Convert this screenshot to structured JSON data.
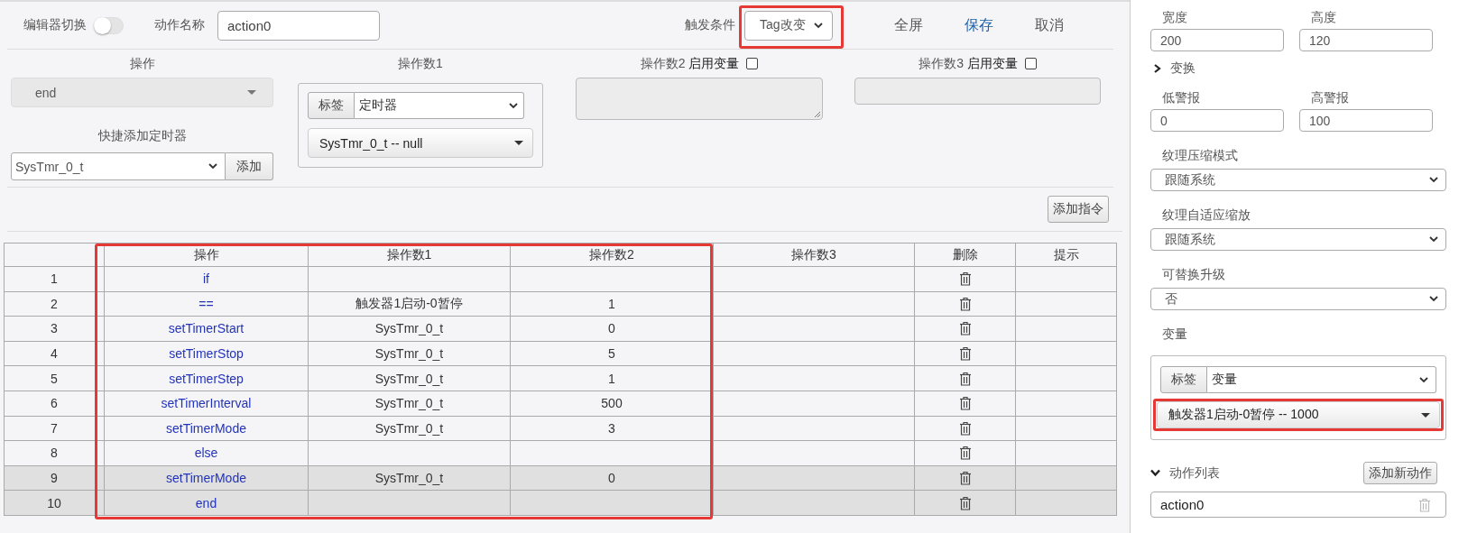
{
  "toolbar": {
    "editor_switch": {
      "label": "编辑器切换",
      "on": false
    },
    "action_name": {
      "label": "动作名称",
      "value": "action0"
    },
    "trigger": {
      "label": "触发条件",
      "value": "Tag改变",
      "marked": true
    },
    "buttons": [
      {
        "label": "全屏",
        "kind": "plain"
      },
      {
        "label": "保存",
        "kind": "primary"
      },
      {
        "label": "取消",
        "kind": "plain"
      }
    ]
  },
  "operation": {
    "label": "操作",
    "value": "end",
    "disabled": true
  },
  "quick_timer": {
    "label": "快捷添加定时器",
    "value": "SysTmr_0_t",
    "button": "添加"
  },
  "operands": [
    {
      "label": "操作数1",
      "kind": "tag",
      "tag_button": "标签",
      "category": "定时器",
      "value": "SysTmr_0_t -- null"
    },
    {
      "label": "操作数2",
      "kind": "textarea",
      "variable_label": "启用变量",
      "checked": false
    },
    {
      "label": "操作数3",
      "kind": "input",
      "variable_label": "启用变量",
      "checked": false
    }
  ],
  "add_instruction": "添加指令",
  "table": {
    "columns": [
      {
        "label": "操作",
        "marked": true
      },
      {
        "label": "操作数1",
        "marked": true
      },
      {
        "label": "操作数2",
        "marked": true
      },
      {
        "label": "操作数3",
        "marked": false
      },
      {
        "label": "删除",
        "marked": false
      },
      {
        "label": "提示",
        "marked": false
      }
    ],
    "rows": [
      {
        "number": "1",
        "operation": "if",
        "highlighted": false
      },
      {
        "number": "2",
        "operation": "==",
        "operand1": "触发器1启动-0暂停",
        "operand2": "1",
        "highlighted": false
      },
      {
        "number": "3",
        "operation": "setTimerStart",
        "operand1": "SysTmr_0_t",
        "operand2": "0",
        "highlighted": false
      },
      {
        "number": "4",
        "operation": "setTimerStop",
        "operand1": "SysTmr_0_t",
        "operand2": "5",
        "highlighted": false
      },
      {
        "number": "5",
        "operation": "setTimerStep",
        "operand1": "SysTmr_0_t",
        "operand2": "1",
        "highlighted": false
      },
      {
        "number": "6",
        "operation": "setTimerInterval",
        "operand1": "SysTmr_0_t",
        "operand2": "500",
        "highlighted": false
      },
      {
        "number": "7",
        "operation": "setTimerMode",
        "operand1": "SysTmr_0_t",
        "operand2": "3",
        "highlighted": false
      },
      {
        "number": "8",
        "operation": "else",
        "highlighted": false
      },
      {
        "number": "9",
        "operation": "setTimerMode",
        "operand1": "SysTmr_0_t",
        "operand2": "0",
        "highlighted": true
      },
      {
        "number": "10",
        "operation": "end",
        "highlighted": true
      }
    ]
  },
  "properties": {
    "size": [
      {
        "label": "宽度",
        "value": "200"
      },
      {
        "label": "高度",
        "value": "120"
      }
    ],
    "transform": {
      "label": "变换",
      "expanded": false
    },
    "alarms": [
      {
        "label": "低警报",
        "value": "0"
      },
      {
        "label": "高警报",
        "value": "100"
      }
    ],
    "selects": [
      {
        "label": "纹理压缩模式",
        "value": "跟随系统"
      },
      {
        "label": "纹理自适应缩放",
        "value": "跟随系统"
      },
      {
        "label": "可替换升级",
        "value": "否"
      }
    ],
    "variable": {
      "label": "变量",
      "tag_button": "标签",
      "category": "变量",
      "value": "触发器1启动-0暂停 -- 1000",
      "marked": true
    },
    "action_list": {
      "label": "动作列表",
      "expanded": true,
      "button": "添加新动作",
      "items": [
        "action0"
      ]
    }
  }
}
